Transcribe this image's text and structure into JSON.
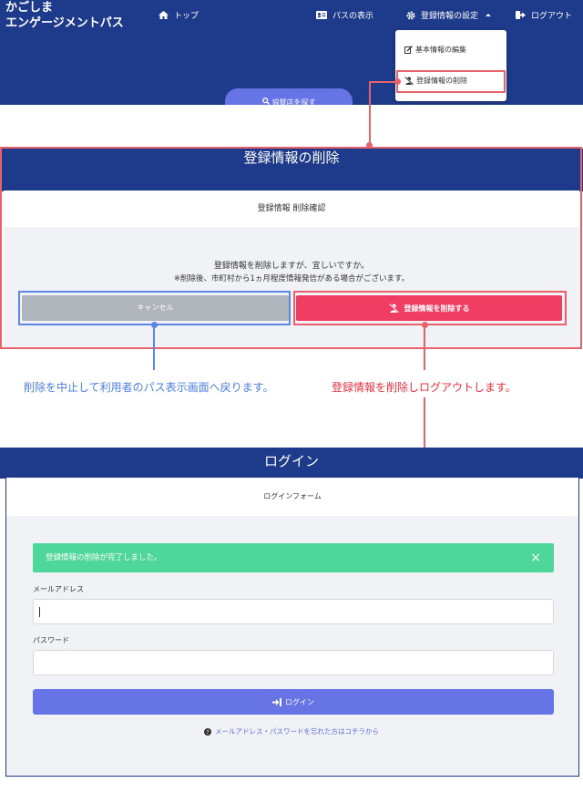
{
  "nav": {
    "brand_line1": "かごしま",
    "brand_line2": "エンゲージメントパス",
    "top_label": "トップ",
    "pass_label": "パスの表示",
    "settings_label": "登録情報の設定",
    "logout_label": "ログアウト",
    "search_label": "協賛店を探す"
  },
  "dropdown": {
    "edit_label": "基本情報の編集",
    "delete_label": "登録情報の削除"
  },
  "delete_page": {
    "title": "登録情報の削除",
    "card_title": "登録情報 削除確認",
    "message1": "登録情報を削除しますが、宜しいですか。",
    "message2": "※削除後、市町村から1ヵ月程度情報発信がある場合がございます。",
    "cancel_label": "キャンセル",
    "delete_label": "登録情報を削除する"
  },
  "annotations": {
    "cancel_note": "削除を中止して利用者のパス表示画面へ戻ります。",
    "delete_note": "登録情報を削除しログアウトします。"
  },
  "login_page": {
    "title": "ログイン",
    "card_title": "ログインフォーム",
    "alert_message": "登録情報の削除が完了しました。",
    "alert_close": "×",
    "email_label": "メールアドレス",
    "email_value": "",
    "password_label": "パスワード",
    "password_value": "",
    "login_label": "ログイン",
    "forgot_label": "メールアドレス・パスワードを忘れた方はコチラから"
  },
  "colors": {
    "primary": "#1e3a8a",
    "accent": "#6674e5",
    "danger": "#f03e63",
    "success": "#4fd69a",
    "annotation_red": "#e8626b",
    "annotation_blue": "#5b86e5"
  }
}
